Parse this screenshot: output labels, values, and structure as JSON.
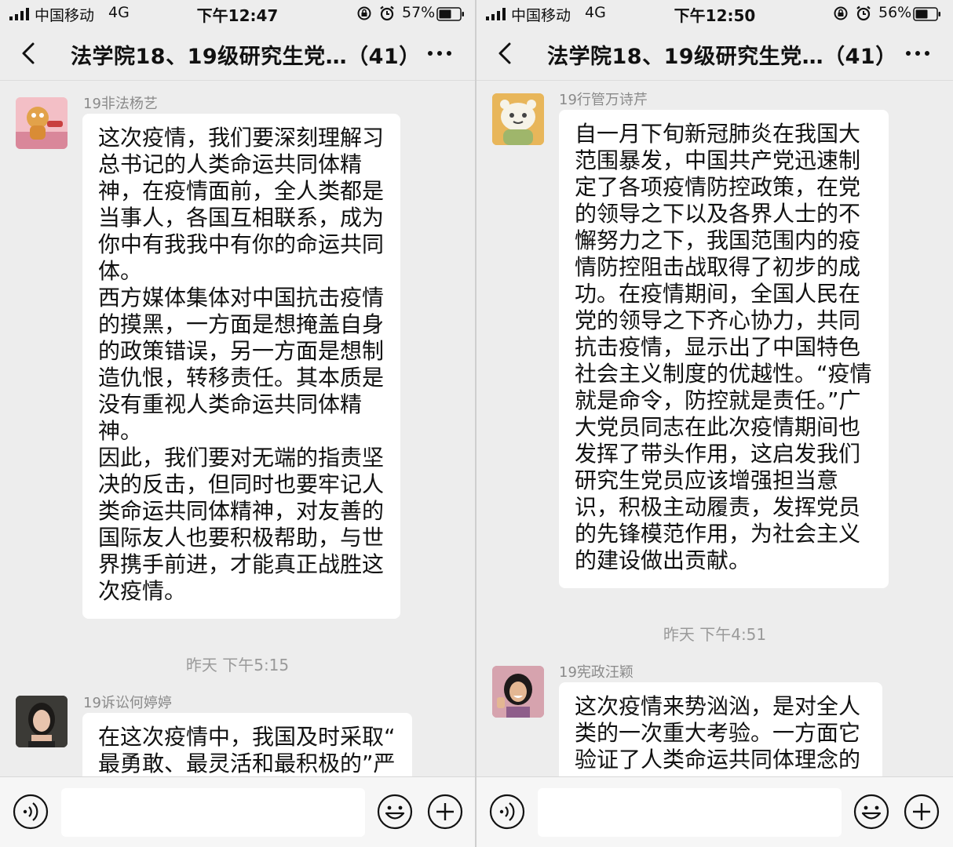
{
  "left": {
    "status": {
      "carrier": "中国移动",
      "network": "4G",
      "time": "下午12:47",
      "battery": "57%"
    },
    "nav": {
      "title": "法学院18、19级研究生党…（41）"
    },
    "messages": [
      {
        "sender": "19非法杨艺",
        "lines": [
          "这次疫情，我们要深刻理解习",
          "总书记的人类命运共同体精",
          "神，在疫情面前，全人类都是",
          "当事人，各国互相联系，成为",
          "你中有我我中有你的命运共同",
          "体。",
          "西方媒体集体对中国抗击疫情",
          "的摸黑，一方面是想掩盖自身",
          "的政策错误，另一方面是想制",
          "造仇恨，转移责任。其本质是",
          "没有重视人类命运共同体精",
          "神。",
          "因此，我们要对无端的指责坚",
          "决的反击，但同时也要牢记人",
          "类命运共同体精神，对友善的",
          "国际友人也要积极帮助，与世",
          "界携手前进，才能真正战胜这",
          "次疫情。"
        ]
      },
      {
        "sender": "19诉讼何婷婷",
        "lines": [
          "在这次疫情中，我国及时采取“",
          "最勇敢、最灵活和最积极的”严"
        ]
      }
    ],
    "time_label": "昨天  下午5:15"
  },
  "right": {
    "status": {
      "carrier": "中国移动",
      "network": "4G",
      "time": "下午12:50",
      "battery": "56%"
    },
    "nav": {
      "title": "法学院18、19级研究生党…（41）"
    },
    "messages": [
      {
        "sender": "19行管万诗芹",
        "lines": [
          "自一月下旬新冠肺炎在我国大",
          "范围暴发，中国共产党迅速制",
          "定了各项疫情防控政策，在党",
          "的领导之下以及各界人士的不",
          "懈努力之下，我国范围内的疫",
          "情防控阻击战取得了初步的成",
          "功。在疫情期间，全国人民在",
          "党的领导之下齐心协力，共同",
          "抗击疫情，显示出了中国特色",
          "社会主义制度的优越性。“疫情",
          "就是命令，防控就是责任。”广",
          "大党员同志在此次疫情期间也",
          "发挥了带头作用，这启发我们",
          "研究生党员应该增强担当意",
          "识，积极主动履责，发挥党员",
          "的先锋模范作用，为社会主义",
          "的建设做出贡献。"
        ]
      },
      {
        "sender": "19宪政汪颖",
        "lines": [
          "这次疫情来势汹汹，是对全人",
          "类的一次重大考验。一方面它",
          "验证了人类命运共同体理念的"
        ]
      }
    ],
    "time_label": "昨天  下午4:51"
  },
  "colors": {
    "background": "#ededed",
    "bubble": "#ffffff",
    "meta_text": "#8a8a8a"
  }
}
